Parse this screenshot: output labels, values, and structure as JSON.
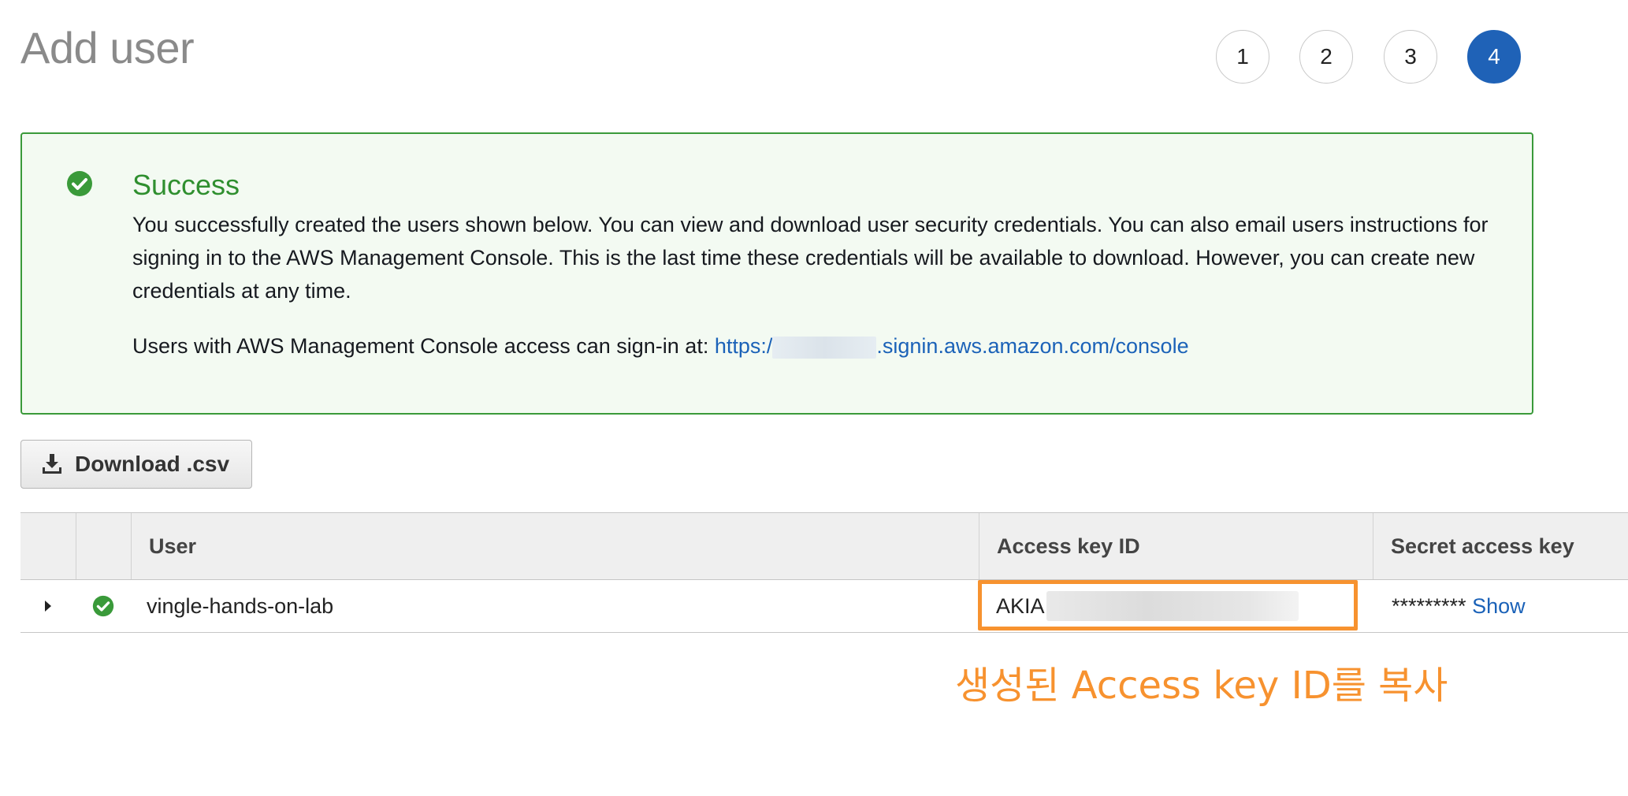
{
  "page": {
    "title": "Add user"
  },
  "steps": [
    {
      "label": "1",
      "active": false
    },
    {
      "label": "2",
      "active": false
    },
    {
      "label": "3",
      "active": false
    },
    {
      "label": "4",
      "active": true
    }
  ],
  "alert": {
    "icon": "check-circle-icon",
    "title": "Success",
    "body": "You successfully created the users shown below. You can view and download user security credentials. You can also email users instructions for signing in to the AWS Management Console. This is the last time these credentials will be available to download. However, you can create new credentials at any time.",
    "signin_prefix": "Users with AWS Management Console access can sign-in at:",
    "signin_link_start": "https:/",
    "signin_link_end": ".signin.aws.amazon.com/console"
  },
  "download_button": {
    "label": "Download .csv",
    "icon": "download-icon"
  },
  "table": {
    "columns": [
      "User",
      "Access key ID",
      "Secret access key"
    ],
    "rows": [
      {
        "expand_icon": "caret-right-icon",
        "status_icon": "check-circle-icon",
        "user": "vingle-hands-on-lab",
        "access_key_prefix": "AKIA",
        "secret_masked": "*********",
        "secret_show": "Show"
      }
    ]
  },
  "annotation": {
    "text": "생성된 Access key ID를 복사"
  },
  "colors": {
    "success": "#3a9a3a",
    "link": "#1b62b8",
    "step_active": "#1f62b7",
    "highlight": "#f7922f"
  }
}
